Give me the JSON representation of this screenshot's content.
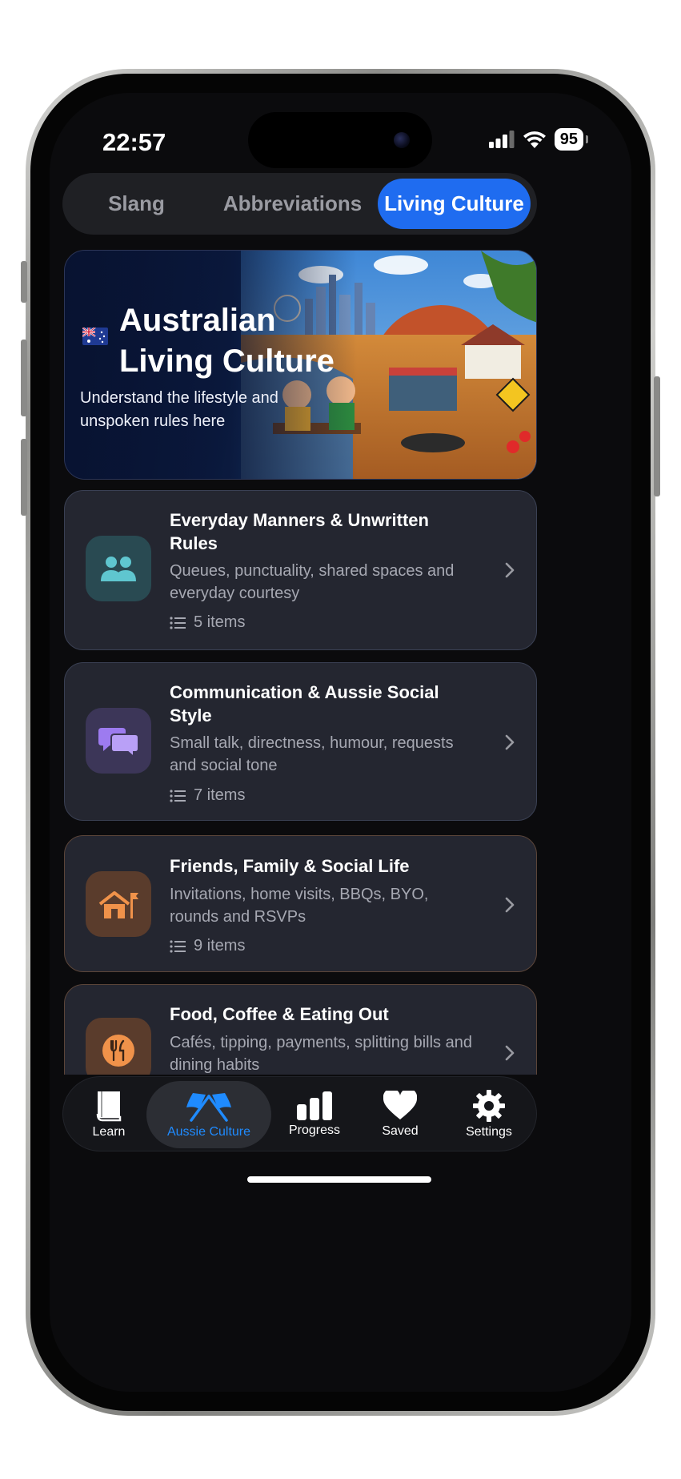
{
  "status_bar": {
    "time": "22:57",
    "battery": "95"
  },
  "segments": [
    {
      "label": "Slang"
    },
    {
      "label": "Abbreviations"
    },
    {
      "label": "Living Culture"
    }
  ],
  "hero": {
    "title_line1": "Australian",
    "title_line2": "Living Culture",
    "subtitle": "Understand the lifestyle and unspoken rules here"
  },
  "cards": [
    {
      "title": "Everyday Manners & Unwritten Rules",
      "description": "Queues, punctuality, shared spaces and everyday courtesy",
      "count": "5 items",
      "icon": "people-icon",
      "color": "#5fc6cf"
    },
    {
      "title": "Communication & Aussie Social Style",
      "description": "Small talk, directness, humour, requests and social tone",
      "count": "7 items",
      "icon": "chat-bubbles-icon",
      "color": "#9d7bf0"
    },
    {
      "title": "Friends, Family & Social Life",
      "description": "Invitations, home visits, BBQs, BYO, rounds and RSVPs",
      "count": "9 items",
      "icon": "home-flag-icon",
      "color": "#f0924a"
    },
    {
      "title": "Food, Coffee & Eating Out",
      "description": "Cafés, tipping, payments, splitting bills and dining habits",
      "icon": "fork-knife-icon",
      "color": "#f0924a"
    }
  ],
  "tabbar": [
    {
      "label": "Learn",
      "icon": "book-icon"
    },
    {
      "label": "Aussie Culture",
      "icon": "flags-icon"
    },
    {
      "label": "Progress",
      "icon": "bar-chart-icon"
    },
    {
      "label": "Saved",
      "icon": "heart-icon"
    },
    {
      "label": "Settings",
      "icon": "gear-icon"
    }
  ],
  "colors": {
    "accent": "#1f6cf0",
    "active_tab": "#1f8bff"
  }
}
